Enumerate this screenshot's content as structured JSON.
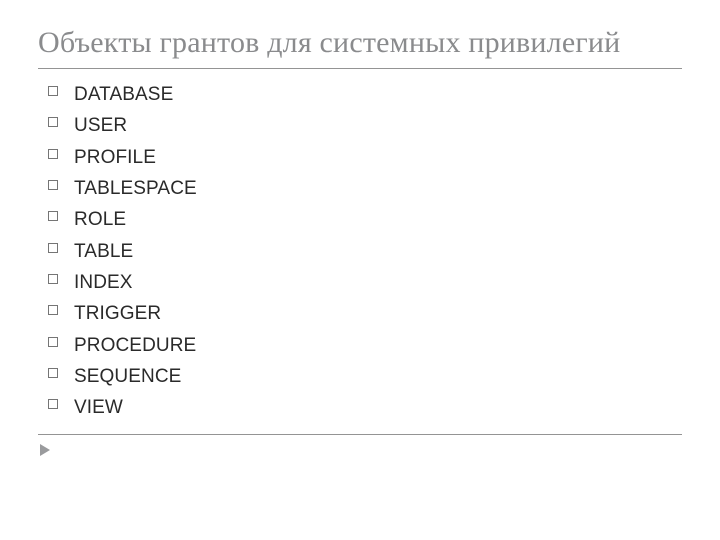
{
  "title": "Объекты грантов для системных привилегий",
  "items": [
    "DATABASE",
    "USER",
    "PROFILE",
    "TABLESPACE",
    "ROLE",
    "TABLE",
    "INDEX",
    "TRIGGER",
    "PROCEDURE",
    "SEQUENCE",
    "VIEW"
  ]
}
